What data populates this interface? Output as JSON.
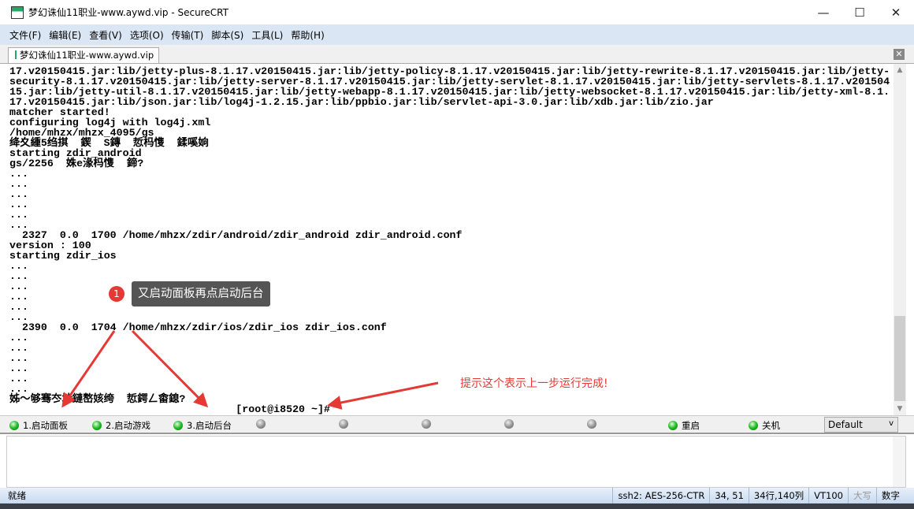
{
  "window": {
    "title": "梦幻诛仙11职业-www.aywd.vip - SecureCRT",
    "minimize": "—",
    "maximize": "☐",
    "close": "✕"
  },
  "menu": [
    "文件(F)",
    "编辑(E)",
    "查看(V)",
    "选项(O)",
    "传输(T)",
    "脚本(S)",
    "工具(L)",
    "帮助(H)"
  ],
  "tab": {
    "label": "梦幻诛仙11职业-www.aywd.vip",
    "close": "✕"
  },
  "terminal": {
    "lines": [
      "17.v20150415.jar:lib/jetty-plus-8.1.17.v20150415.jar:lib/jetty-policy-8.1.17.v20150415.jar:lib/jetty-rewrite-8.1.17.v20150415.jar:lib/jetty-",
      "security-8.1.17.v20150415.jar:lib/jetty-server-8.1.17.v20150415.jar:lib/jetty-servlet-8.1.17.v20150415.jar:lib/jetty-servlets-8.1.17.v201504",
      "15.jar:lib/jetty-util-8.1.17.v20150415.jar:lib/jetty-webapp-8.1.17.v20150415.jar:lib/jetty-websocket-8.1.17.v20150415.jar:lib/jetty-xml-8.1.",
      "17.v20150415.jar:lib/json.jar:lib/log4j-1.2.15.jar:lib/ppbio.jar:lib/servlet-api-3.0.jar:lib/xdb.jar:lib/zio.jar",
      "matcher started!",
      "configuring log4j with log4j.xml",
      "/home/mhzx/mhzx_4095/gs",
      "绛夊緟5绉掑  鍥  S鏄  悊杩愯  鍒嗘姠",
      "starting zdir_android",
      "gs/2256  姝e湪杩愯  鍗?",
      "...",
      "...",
      "...",
      "...",
      "...",
      "...",
      "  2327  0.0  1700 /home/mhzx/zdir/android/zdir_android zdir_android.conf",
      "version : 100",
      "starting zdir_ios",
      "...",
      "...",
      "...",
      "...",
      "...",
      "...",
      "  2390  0.0  1704 /home/mhzx/zdir/ios/zdir_ios zdir_ios.conf",
      "...",
      "...",
      "...",
      "...",
      "...",
      "...",
      "姊～够骞冭埗鏈嶅姟绔  悊鍔ㄥ畬鎴?",
      "                                    [root@i8520 ~]#"
    ]
  },
  "buttons": [
    {
      "label": "1.启动面板",
      "on": true
    },
    {
      "label": "2.启动游戏",
      "on": true
    },
    {
      "label": "3.启动后台",
      "on": true
    },
    {
      "label": "",
      "on": false
    },
    {
      "label": "",
      "on": false
    },
    {
      "label": "",
      "on": false
    },
    {
      "label": "",
      "on": false
    },
    {
      "label": "",
      "on": false
    },
    {
      "label": "重启",
      "on": true
    },
    {
      "label": "关机",
      "on": true
    }
  ],
  "session_select": {
    "value": "Default"
  },
  "status": {
    "ready": "就绪",
    "cipher": "ssh2: AES-256-CTR",
    "cursor": "34,  51",
    "size": "34行,140列",
    "emulation": "VT100",
    "caps": "大写",
    "num": "数字"
  },
  "annotations": {
    "step_number": "1",
    "callout": "又启动面板再点启动后台",
    "hint": "提示这个表示上一步运行完成!",
    "color": "#e53935"
  }
}
